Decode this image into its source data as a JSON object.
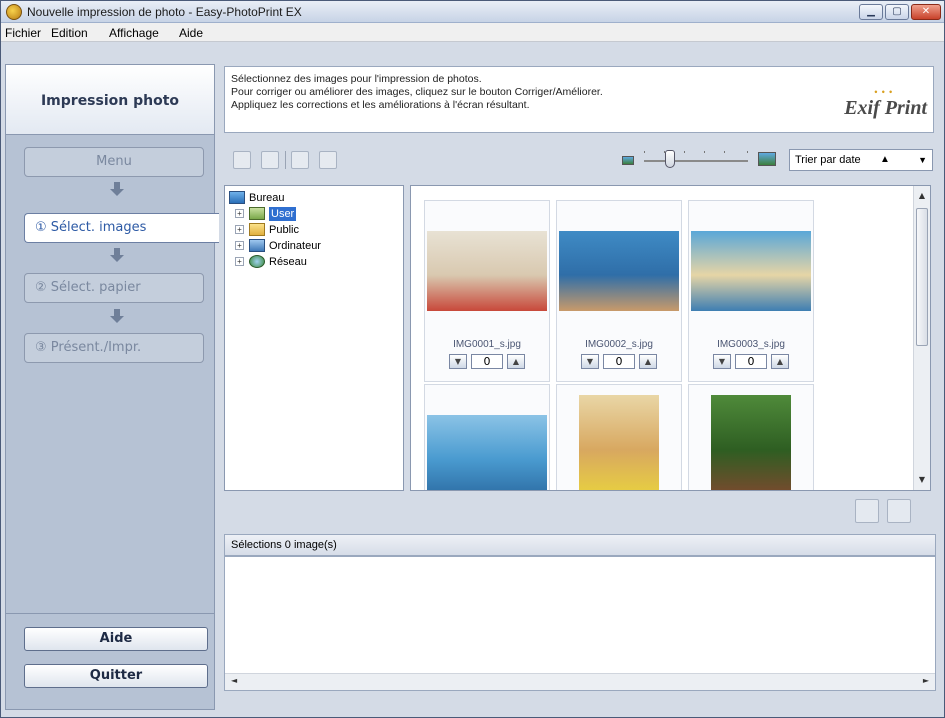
{
  "window": {
    "title": "Nouvelle impression de photo - Easy-PhotoPrint EX",
    "controls": [
      "minimize",
      "maximize",
      "close"
    ]
  },
  "menubar": {
    "items": [
      "Fichier",
      "Edition",
      "Affichage",
      "Aide"
    ]
  },
  "left_panel": {
    "title": "Impression photo",
    "menu_label": "Menu",
    "steps": [
      {
        "label": "① Sélect. images",
        "active": true
      },
      {
        "label": "② Sélect. papier",
        "active": false
      },
      {
        "label": "③ Présent./Impr.",
        "active": false
      }
    ],
    "help_label": "Aide",
    "quit_label": "Quitter"
  },
  "info": {
    "lines": [
      "Sélectionnez des images pour l'impression de photos.",
      "Pour corriger ou améliorer des images, cliquez sur le bouton Corriger/Améliorer.",
      "Appliquez les corrections et les améliorations à l'écran résultant."
    ],
    "logo_text": "Exif Print"
  },
  "toolbar": {
    "sort_label": "Trier par date",
    "sort_direction_icon": "▲",
    "zoom_level": 0.25
  },
  "tree": {
    "root": "Bureau",
    "children": [
      "User",
      "Public",
      "Ordinateur",
      "Réseau"
    ],
    "selected": "User"
  },
  "thumbnails": [
    {
      "filename": "IMG0001_s.jpg",
      "quantity": "0",
      "colors": [
        "#e8e2d4",
        "#d9c9b0",
        "#c8483a"
      ]
    },
    {
      "filename": "IMG0002_s.jpg",
      "quantity": "0",
      "colors": [
        "#3f8bc5",
        "#2f6ea8",
        "#c89a6a"
      ]
    },
    {
      "filename": "IMG0003_s.jpg",
      "quantity": "0",
      "colors": [
        "#5aa7d8",
        "#e6d5a6",
        "#3e7eb2"
      ]
    },
    {
      "filename": "",
      "quantity": "",
      "colors": [
        "#8bc3e6",
        "#4a9bd0",
        "#2e6fa6"
      ]
    },
    {
      "filename": "",
      "quantity": "",
      "colors": [
        "#e9d6a6",
        "#d8a860",
        "#e8d040"
      ]
    },
    {
      "filename": "",
      "quantity": "",
      "colors": [
        "#4f8a3a",
        "#2e5e22",
        "#7a4a2e"
      ]
    }
  ],
  "selection": {
    "header": "Sélections 0 image(s)"
  }
}
